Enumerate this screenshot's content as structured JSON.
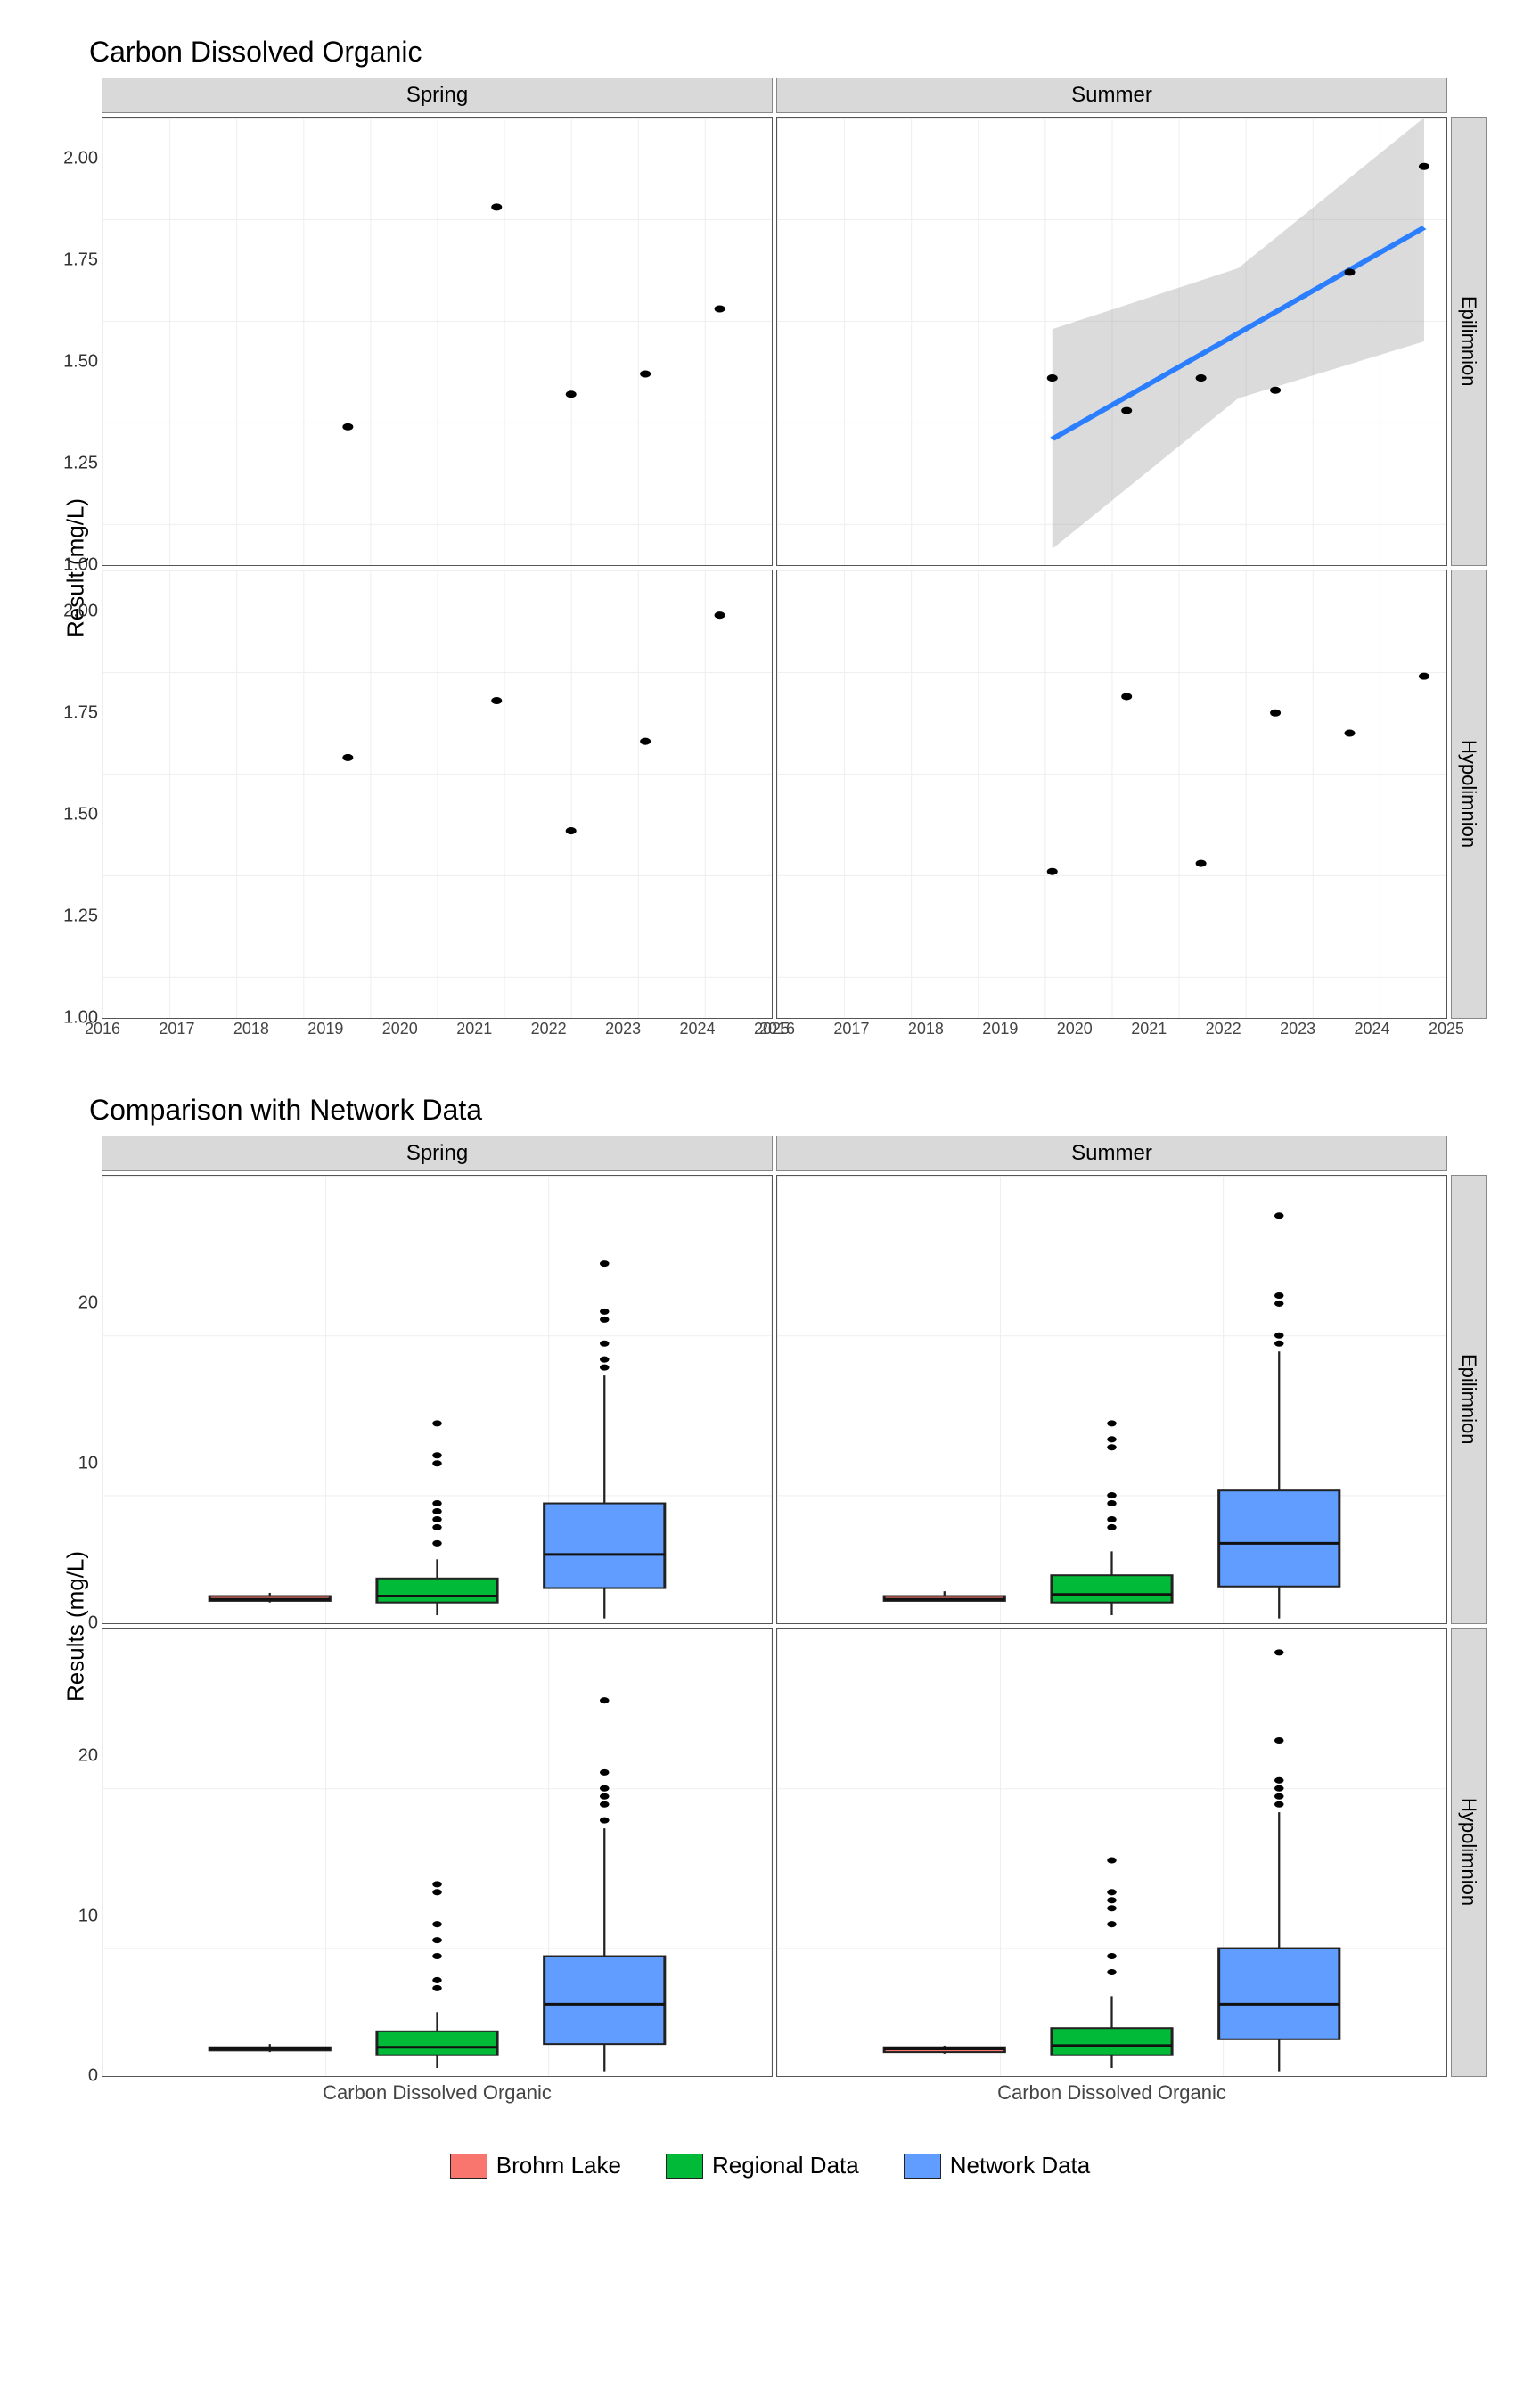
{
  "chart_data": [
    {
      "id": "scatter_facets",
      "type": "scatter",
      "title": "Carbon Dissolved Organic",
      "xlabel": "",
      "ylabel": "Result (mg/L)",
      "xlim": [
        2016,
        2025
      ],
      "ylim": [
        1.0,
        2.1
      ],
      "facet_cols": [
        "Spring",
        "Summer"
      ],
      "facet_rows": [
        "Epilimnion",
        "Hypolimnion"
      ],
      "y_ticks": [
        1.0,
        1.25,
        1.5,
        1.75,
        2.0
      ],
      "x_ticks": [
        2016,
        2017,
        2018,
        2019,
        2020,
        2021,
        2022,
        2023,
        2024,
        2025
      ],
      "panels": {
        "Spring|Epilimnion": {
          "points": [
            {
              "x": 2019.3,
              "y": 1.34
            },
            {
              "x": 2021.3,
              "y": 1.88
            },
            {
              "x": 2022.3,
              "y": 1.42
            },
            {
              "x": 2023.3,
              "y": 1.47
            },
            {
              "x": 2024.3,
              "y": 1.63
            }
          ],
          "trend": null
        },
        "Summer|Epilimnion": {
          "points": [
            {
              "x": 2019.7,
              "y": 1.46
            },
            {
              "x": 2020.7,
              "y": 1.38
            },
            {
              "x": 2021.7,
              "y": 1.46
            },
            {
              "x": 2022.7,
              "y": 1.43
            },
            {
              "x": 2023.7,
              "y": 1.72
            },
            {
              "x": 2024.7,
              "y": 1.98
            }
          ],
          "trend": {
            "line": [
              {
                "x": 2019.7,
                "y": 1.31
              },
              {
                "x": 2024.7,
                "y": 1.83
              }
            ],
            "ribbon": [
              {
                "x": 2019.7,
                "lo": 1.04,
                "hi": 1.58
              },
              {
                "x": 2022.2,
                "lo": 1.41,
                "hi": 1.73
              },
              {
                "x": 2024.7,
                "lo": 1.55,
                "hi": 2.1
              }
            ]
          }
        },
        "Spring|Hypolimnion": {
          "points": [
            {
              "x": 2019.3,
              "y": 1.64
            },
            {
              "x": 2021.3,
              "y": 1.78
            },
            {
              "x": 2022.3,
              "y": 1.46
            },
            {
              "x": 2023.3,
              "y": 1.68
            },
            {
              "x": 2024.3,
              "y": 1.99
            }
          ],
          "trend": null
        },
        "Summer|Hypolimnion": {
          "points": [
            {
              "x": 2019.7,
              "y": 1.36
            },
            {
              "x": 2020.7,
              "y": 1.79
            },
            {
              "x": 2021.7,
              "y": 1.38
            },
            {
              "x": 2022.7,
              "y": 1.75
            },
            {
              "x": 2023.7,
              "y": 1.7
            },
            {
              "x": 2024.7,
              "y": 1.84
            }
          ],
          "trend": null
        }
      }
    },
    {
      "id": "boxplot_facets",
      "type": "box",
      "title": "Comparison with Network Data",
      "xlabel": "Carbon Dissolved Organic",
      "ylabel": "Results (mg/L)",
      "ylim": [
        0,
        28
      ],
      "facet_cols": [
        "Spring",
        "Summer"
      ],
      "facet_rows": [
        "Epilimnion",
        "Hypolimnion"
      ],
      "y_ticks": [
        0,
        10,
        20
      ],
      "categories": [
        "Brohm Lake",
        "Regional Data",
        "Network Data"
      ],
      "colors": {
        "Brohm Lake": "#F8766D",
        "Regional Data": "#00BA38",
        "Network Data": "#619CFF"
      },
      "panels": {
        "Spring|Epilimnion": {
          "boxes": [
            {
              "cat": "Brohm Lake",
              "min": 1.3,
              "q1": 1.4,
              "med": 1.5,
              "q3": 1.7,
              "max": 1.9,
              "out": []
            },
            {
              "cat": "Regional Data",
              "min": 0.5,
              "q1": 1.3,
              "med": 1.7,
              "q3": 2.8,
              "max": 4.0,
              "out": [
                5.0,
                6.0,
                6.5,
                7.0,
                7.5,
                10.0,
                10.5,
                12.5
              ]
            },
            {
              "cat": "Network Data",
              "min": 0.3,
              "q1": 2.2,
              "med": 4.3,
              "q3": 7.5,
              "max": 15.5,
              "out": [
                16.0,
                16.5,
                17.5,
                19.0,
                19.5,
                22.5
              ]
            }
          ]
        },
        "Summer|Epilimnion": {
          "boxes": [
            {
              "cat": "Brohm Lake",
              "min": 1.4,
              "q1": 1.4,
              "med": 1.5,
              "q3": 1.7,
              "max": 2.0,
              "out": []
            },
            {
              "cat": "Regional Data",
              "min": 0.5,
              "q1": 1.3,
              "med": 1.8,
              "q3": 3.0,
              "max": 4.5,
              "out": [
                6.0,
                6.5,
                7.5,
                8.0,
                11.0,
                11.5,
                12.5
              ]
            },
            {
              "cat": "Network Data",
              "min": 0.3,
              "q1": 2.3,
              "med": 5.0,
              "q3": 8.3,
              "max": 17.0,
              "out": [
                17.5,
                18.0,
                20.0,
                20.5,
                25.5
              ]
            }
          ]
        },
        "Spring|Hypolimnion": {
          "boxes": [
            {
              "cat": "Brohm Lake",
              "min": 1.5,
              "q1": 1.6,
              "med": 1.7,
              "q3": 1.8,
              "max": 2.0,
              "out": []
            },
            {
              "cat": "Regional Data",
              "min": 0.5,
              "q1": 1.3,
              "med": 1.8,
              "q3": 2.8,
              "max": 4.0,
              "out": [
                5.5,
                6.0,
                7.5,
                8.5,
                9.5,
                11.5,
                12.0
              ]
            },
            {
              "cat": "Network Data",
              "min": 0.3,
              "q1": 2.0,
              "med": 4.5,
              "q3": 7.5,
              "max": 15.5,
              "out": [
                16.0,
                17.0,
                17.5,
                18.0,
                19.0,
                23.5
              ]
            }
          ]
        },
        "Summer|Hypolimnion": {
          "boxes": [
            {
              "cat": "Brohm Lake",
              "min": 1.4,
              "q1": 1.5,
              "med": 1.7,
              "q3": 1.8,
              "max": 1.9,
              "out": []
            },
            {
              "cat": "Regional Data",
              "min": 0.5,
              "q1": 1.3,
              "med": 1.9,
              "q3": 3.0,
              "max": 5.0,
              "out": [
                6.5,
                7.5,
                9.5,
                10.5,
                11.0,
                11.5,
                13.5
              ]
            },
            {
              "cat": "Network Data",
              "min": 0.3,
              "q1": 2.3,
              "med": 4.5,
              "q3": 8.0,
              "max": 16.5,
              "out": [
                17.0,
                17.5,
                18.0,
                18.5,
                21.0,
                26.5
              ]
            }
          ]
        }
      }
    }
  ],
  "titles": {
    "scatter": "Carbon Dissolved Organic",
    "box": "Comparison with Network Data"
  },
  "axis": {
    "scatter_y": "Result (mg/L)",
    "box_y": "Results (mg/L)",
    "box_x": "Carbon Dissolved Organic"
  },
  "strips": {
    "cols": [
      "Spring",
      "Summer"
    ],
    "rows": [
      "Epilimnion",
      "Hypolimnion"
    ]
  },
  "legend": {
    "items": [
      {
        "label": "Brohm Lake",
        "color": "#F8766D"
      },
      {
        "label": "Regional Data",
        "color": "#00BA38"
      },
      {
        "label": "Network Data",
        "color": "#619CFF"
      }
    ]
  }
}
